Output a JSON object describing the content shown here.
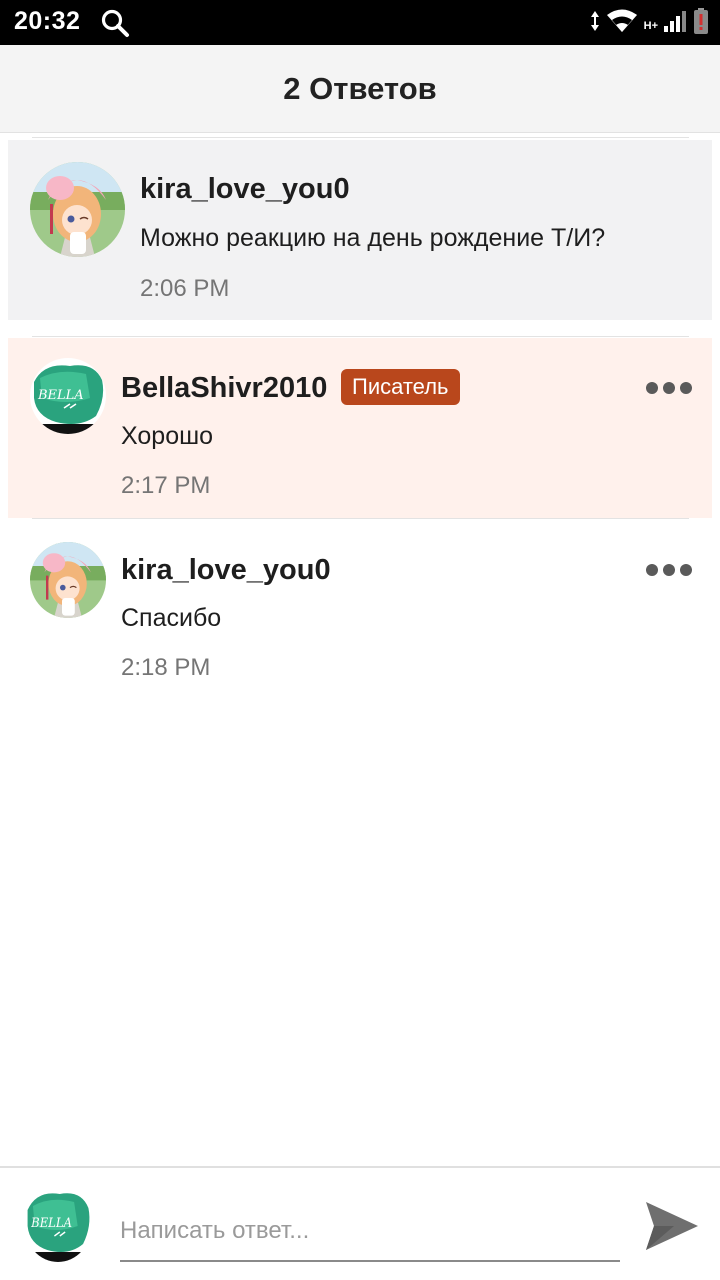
{
  "status_bar": {
    "time": "20:32",
    "network_label": "H+",
    "icons": [
      "search-icon",
      "data-arrows-icon",
      "wifi-icon",
      "signal-icon",
      "battery-alert-icon"
    ]
  },
  "header": {
    "title": "2 Ответов"
  },
  "comments": [
    {
      "username": "kira_love_you0",
      "text": "Можно реакцию на день рождение Т/И?",
      "time": "2:06 PM",
      "avatar": "anime-girl-avatar"
    },
    {
      "username": "BellaShivr2010",
      "badge": "Писатель",
      "text": "Хорошо",
      "time": "2:17 PM",
      "avatar": "bella-green-avatar"
    },
    {
      "username": "kira_love_you0",
      "text": "Спасибо",
      "time": "2:18 PM",
      "avatar": "anime-girl-avatar"
    }
  ],
  "composer": {
    "placeholder": "Написать ответ...",
    "avatar": "bella-green-avatar",
    "send_icon": "send-icon"
  },
  "colors": {
    "badge_bg": "#b9471c",
    "highlight_bg": "#fff1ec",
    "op_bg": "#f2f2f3"
  }
}
